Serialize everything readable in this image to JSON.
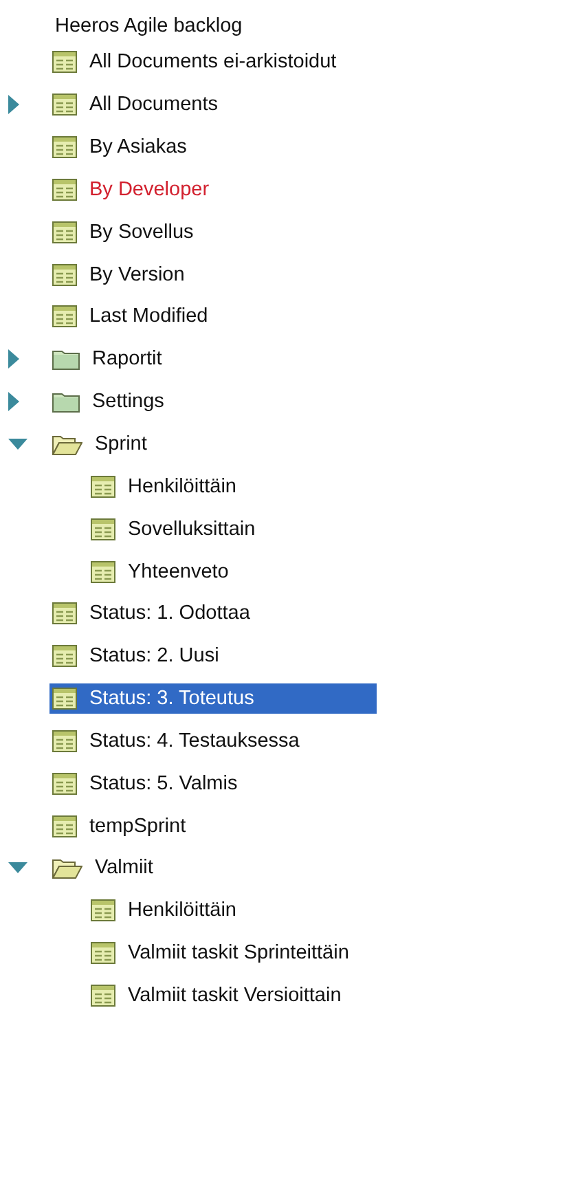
{
  "title": "Heeros Agile backlog",
  "items": [
    {
      "label": "All Documents ei-arkistoidut",
      "kind": "view",
      "selected": false,
      "highlighted": false
    },
    {
      "label": "All Documents",
      "kind": "view",
      "selected": false,
      "highlighted": false,
      "expanded": false
    },
    {
      "label": "By Asiakas",
      "kind": "view",
      "selected": false,
      "highlighted": false
    },
    {
      "label": "By Developer",
      "kind": "view",
      "selected": false,
      "highlighted": true
    },
    {
      "label": "By Sovellus",
      "kind": "view",
      "selected": false,
      "highlighted": false
    },
    {
      "label": "By Version",
      "kind": "view",
      "selected": false,
      "highlighted": false
    },
    {
      "label": "Last Modified",
      "kind": "view",
      "selected": false,
      "highlighted": false
    },
    {
      "label": "Raportit",
      "kind": "folder",
      "selected": false,
      "highlighted": false,
      "expanded": false
    },
    {
      "label": "Settings",
      "kind": "folder",
      "selected": false,
      "highlighted": false,
      "expanded": false
    },
    {
      "label": "Sprint",
      "kind": "folder",
      "selected": false,
      "highlighted": false,
      "expanded": true,
      "children": [
        {
          "label": "Henkilöittäin",
          "kind": "view",
          "selected": false,
          "highlighted": false
        },
        {
          "label": "Sovelluksittain",
          "kind": "view",
          "selected": false,
          "highlighted": false
        },
        {
          "label": "Yhteenveto",
          "kind": "view",
          "selected": false,
          "highlighted": false
        }
      ]
    },
    {
      "label": "Status: 1. Odottaa",
      "kind": "view",
      "selected": false,
      "highlighted": false
    },
    {
      "label": "Status: 2. Uusi",
      "kind": "view",
      "selected": false,
      "highlighted": false
    },
    {
      "label": "Status: 3. Toteutus",
      "kind": "view",
      "selected": true,
      "highlighted": false
    },
    {
      "label": "Status: 4. Testauksessa",
      "kind": "view",
      "selected": false,
      "highlighted": false
    },
    {
      "label": "Status: 5. Valmis",
      "kind": "view",
      "selected": false,
      "highlighted": false
    },
    {
      "label": "tempSprint",
      "kind": "view",
      "selected": false,
      "highlighted": false
    },
    {
      "label": "Valmiit",
      "kind": "folder",
      "selected": false,
      "highlighted": false,
      "expanded": true,
      "children": [
        {
          "label": "Henkilöittäin",
          "kind": "view",
          "selected": false,
          "highlighted": false
        },
        {
          "label": "Valmiit taskit Sprinteittäin",
          "kind": "view",
          "selected": false,
          "highlighted": false
        },
        {
          "label": "Valmiit taskit Versioittain",
          "kind": "view",
          "selected": false,
          "highlighted": false
        }
      ]
    }
  ]
}
